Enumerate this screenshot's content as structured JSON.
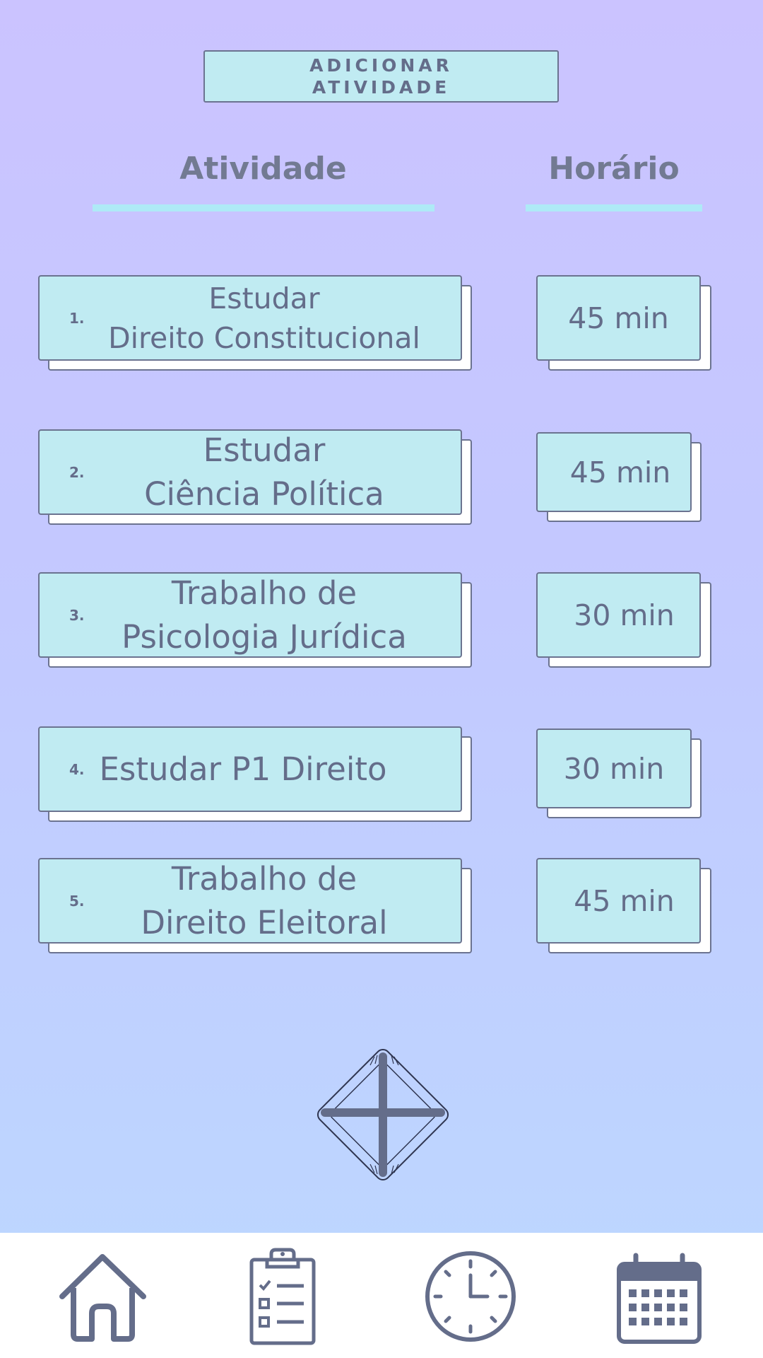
{
  "header": {
    "add_activity_label": "ADICIONAR\nATIVIDADE"
  },
  "columns": {
    "activity": "Atividade",
    "time": "Horário"
  },
  "activities": [
    {
      "number": "1.",
      "label": "Estudar\nDireito Constitucional",
      "time": "45 min"
    },
    {
      "number": "2.",
      "label": "Estudar\nCiência Política",
      "time": "45 min"
    },
    {
      "number": "3.",
      "label": "Trabalho de\nPsicologia Jurídica",
      "time": "30 min"
    },
    {
      "number": "4.",
      "label": "Estudar P1 Direito",
      "time": "30 min"
    },
    {
      "number": "5.",
      "label": "Trabalho de\nDireito Eleitoral",
      "time": "45 min"
    }
  ],
  "actions": {
    "add_icon": "plus-icon"
  },
  "bottom_nav": [
    {
      "icon": "home-icon"
    },
    {
      "icon": "clipboard-checklist-icon"
    },
    {
      "icon": "clock-icon"
    },
    {
      "icon": "calendar-icon"
    }
  ],
  "colors": {
    "background_top": "#cbc3ff",
    "background_bottom": "#bcd8ff",
    "card_fill": "#c0ebf2",
    "outline": "#6b7390",
    "underline": "#aeeaf6"
  }
}
